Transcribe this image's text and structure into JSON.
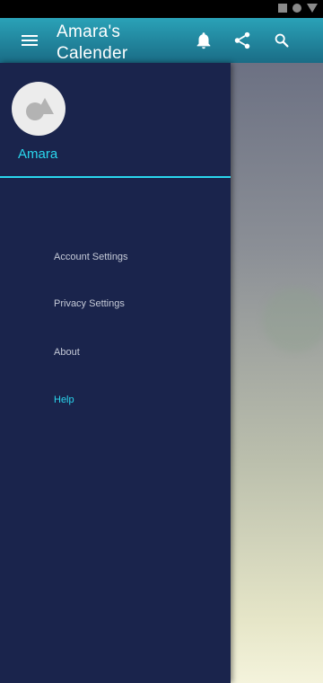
{
  "status_bar": {
    "icons": [
      "square-icon",
      "circle-icon",
      "triangle-icon"
    ]
  },
  "app_bar": {
    "title": "Amara's Calender",
    "menu_icon": "menu-icon",
    "actions": [
      "bell-icon",
      "share-icon",
      "search-icon"
    ]
  },
  "drawer": {
    "user_name": "Amara",
    "avatar_icon": "shapes-icon",
    "items": [
      {
        "label": "Account Settings",
        "active": false
      },
      {
        "label": "Privacy Settings",
        "active": false
      },
      {
        "label": "About",
        "active": false
      },
      {
        "label": "Help",
        "active": true
      }
    ],
    "accent_color": "#2ad7ee",
    "background_color": "#1a244c"
  },
  "colors": {
    "app_bar_top": "#2aa2b8",
    "app_bar_bottom": "#1a6c86"
  }
}
